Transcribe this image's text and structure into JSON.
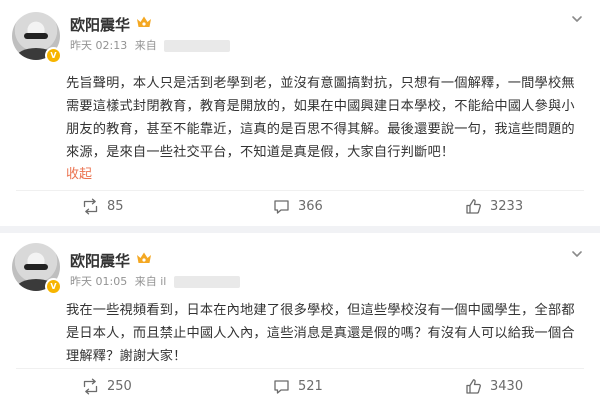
{
  "posts": [
    {
      "username": "欧阳震华",
      "meta_time": "昨天 02:13",
      "meta_source_prefix": "来自",
      "content": "先旨聲明，本人只是活到老學到老，並沒有意圖搞對抗，只想有一個解釋，一間學校無需要這樣式封閉教育，教育是開放的，如果在中國興建日本學校，不能給中國人參與小朋友的教育，甚至不能靠近，這真的是百思不得其解。最後還要說一句，我這些問題的來源，是來自一些社交平台，不知道是真是假，大家自行判斷吧！",
      "collapse_label": "收起",
      "reposts": "85",
      "comments": "366",
      "likes": "3233"
    },
    {
      "username": "欧阳震华",
      "meta_time": "昨天 01:05",
      "meta_source_prefix": "来自 il",
      "content": "我在一些視頻看到，日本在內地建了很多學校，但這些學校沒有一個中國學生，全部都是日本人，而且禁止中國人入內，這些消息是真還是假的嗎？有沒有人可以給我一個合理解釋？謝謝大家！",
      "reposts": "250",
      "comments": "521",
      "likes": "3430"
    }
  ],
  "icons": {
    "verified": "verified-badge-icon",
    "crown": "crown-icon",
    "more": "chevron-down-icon",
    "repost": "repost-icon",
    "comment": "comment-icon",
    "like": "thumbs-up-icon"
  },
  "colors": {
    "collapse_link": "#eb7350",
    "verified_badge": "#f7b500",
    "meta_text": "#939393"
  }
}
